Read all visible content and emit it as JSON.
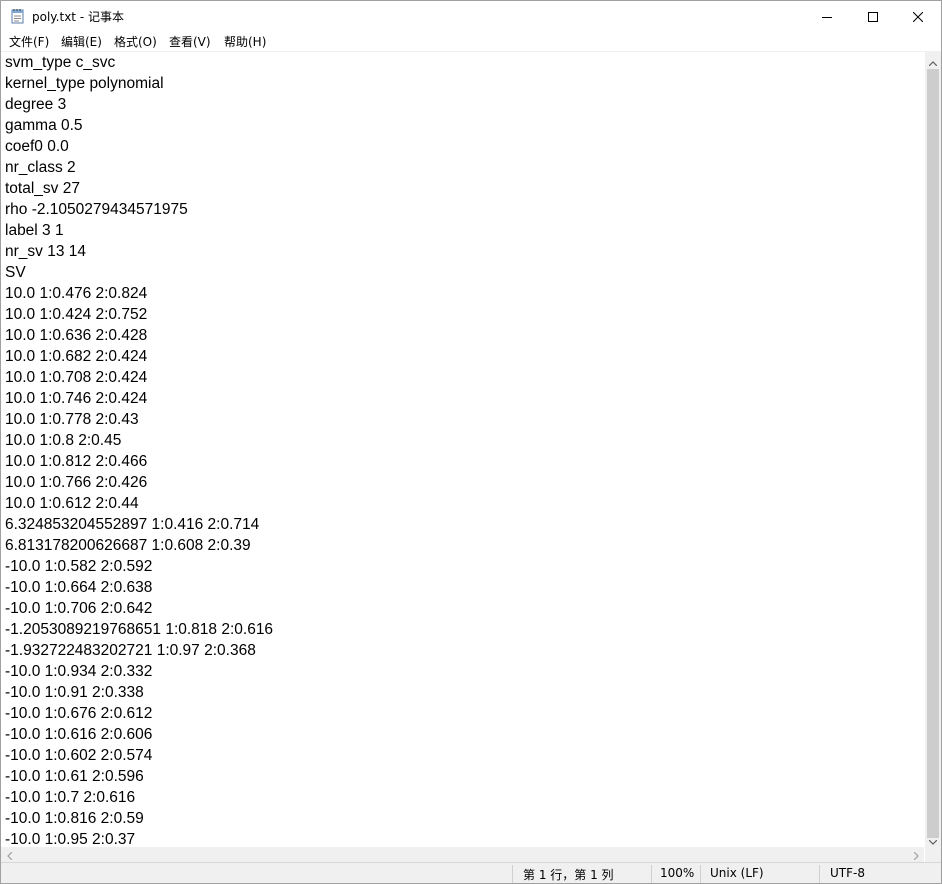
{
  "window": {
    "title": "poly.txt - 记事本",
    "app_icon": "notepad-icon",
    "controls": [
      "minimize-icon",
      "maximize-icon",
      "close-icon"
    ]
  },
  "menu": {
    "items": [
      {
        "label": "文件(F)"
      },
      {
        "label": "编辑(E)"
      },
      {
        "label": "格式(O)"
      },
      {
        "label": "查看(V)"
      },
      {
        "label": "帮助(H)"
      }
    ]
  },
  "editor": {
    "lines": [
      "svm_type c_svc",
      "kernel_type polynomial",
      "degree 3",
      "gamma 0.5",
      "coef0 0.0",
      "nr_class 2",
      "total_sv 27",
      "rho -2.1050279434571975",
      "label 3 1",
      "nr_sv 13 14",
      "SV",
      "10.0 1:0.476 2:0.824",
      "10.0 1:0.424 2:0.752",
      "10.0 1:0.636 2:0.428",
      "10.0 1:0.682 2:0.424",
      "10.0 1:0.708 2:0.424",
      "10.0 1:0.746 2:0.424",
      "10.0 1:0.778 2:0.43",
      "10.0 1:0.8 2:0.45",
      "10.0 1:0.812 2:0.466",
      "10.0 1:0.766 2:0.426",
      "10.0 1:0.612 2:0.44",
      "6.324853204552897 1:0.416 2:0.714",
      "6.813178200626687 1:0.608 2:0.39",
      "-10.0 1:0.582 2:0.592",
      "-10.0 1:0.664 2:0.638",
      "-10.0 1:0.706 2:0.642",
      "-1.2053089219768651 1:0.818 2:0.616",
      "-1.932722483202721 1:0.97 2:0.368",
      "-10.0 1:0.934 2:0.332",
      "-10.0 1:0.91 2:0.338",
      "-10.0 1:0.676 2:0.612",
      "-10.0 1:0.616 2:0.606",
      "-10.0 1:0.602 2:0.574",
      "-10.0 1:0.61 2:0.596",
      "-10.0 1:0.7 2:0.616",
      "-10.0 1:0.816 2:0.59",
      "-10.0 1:0.95 2:0.37"
    ]
  },
  "status": {
    "position": "第 1 行，第 1 列",
    "zoom": "100%",
    "line_ending": "Unix (LF)",
    "encoding": "UTF-8"
  },
  "colors": {
    "background": "#ffffff",
    "chrome": "#f0f0f0",
    "scroll_thumb": "#cdcdcd",
    "text": "#000000"
  }
}
